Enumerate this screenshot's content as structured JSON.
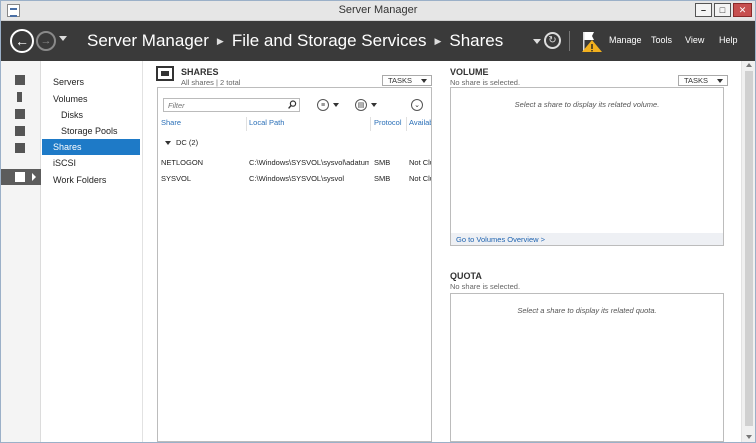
{
  "window": {
    "title": "Server Manager"
  },
  "header": {
    "breadcrumb": [
      "Server Manager",
      "File and Storage Services",
      "Shares"
    ],
    "menu": [
      "Manage",
      "Tools",
      "View",
      "Help"
    ]
  },
  "nav": {
    "items": [
      {
        "label": "Servers",
        "level": 0,
        "selected": false
      },
      {
        "label": "Volumes",
        "level": 0,
        "selected": false
      },
      {
        "label": "Disks",
        "level": 1,
        "selected": false
      },
      {
        "label": "Storage Pools",
        "level": 1,
        "selected": false
      },
      {
        "label": "Shares",
        "level": 0,
        "selected": true
      },
      {
        "label": "iSCSI",
        "level": 0,
        "selected": false
      },
      {
        "label": "Work Folders",
        "level": 0,
        "selected": false
      }
    ]
  },
  "shares": {
    "title": "SHARES",
    "subtitle": "All shares | 2 total",
    "tasks_label": "TASKS",
    "filter_placeholder": "Filter",
    "columns": [
      "Share",
      "Local Path",
      "Protocol",
      "Availability Type"
    ],
    "group_label": "DC (2)",
    "rows": [
      {
        "share": "NETLOGON",
        "path": "C:\\Windows\\SYSVOL\\sysvol\\adatum.com\\SCRIPTS",
        "protocol": "SMB",
        "availability": "Not Clustered"
      },
      {
        "share": "SYSVOL",
        "path": "C:\\Windows\\SYSVOL\\sysvol",
        "protocol": "SMB",
        "availability": "Not Clustered"
      }
    ]
  },
  "volume": {
    "title": "VOLUME",
    "subtitle": "No share is selected.",
    "tasks_label": "TASKS",
    "placeholder": "Select a share to display its related volume.",
    "link": "Go to Volumes Overview >"
  },
  "quota": {
    "title": "QUOTA",
    "subtitle": "No share is selected.",
    "placeholder": "Select a share to display its related quota."
  },
  "colors": {
    "accent": "#1e7ac7",
    "header_bg": "#3a3a3a",
    "link": "#1e63b0",
    "column_header": "#2a6fb7"
  }
}
